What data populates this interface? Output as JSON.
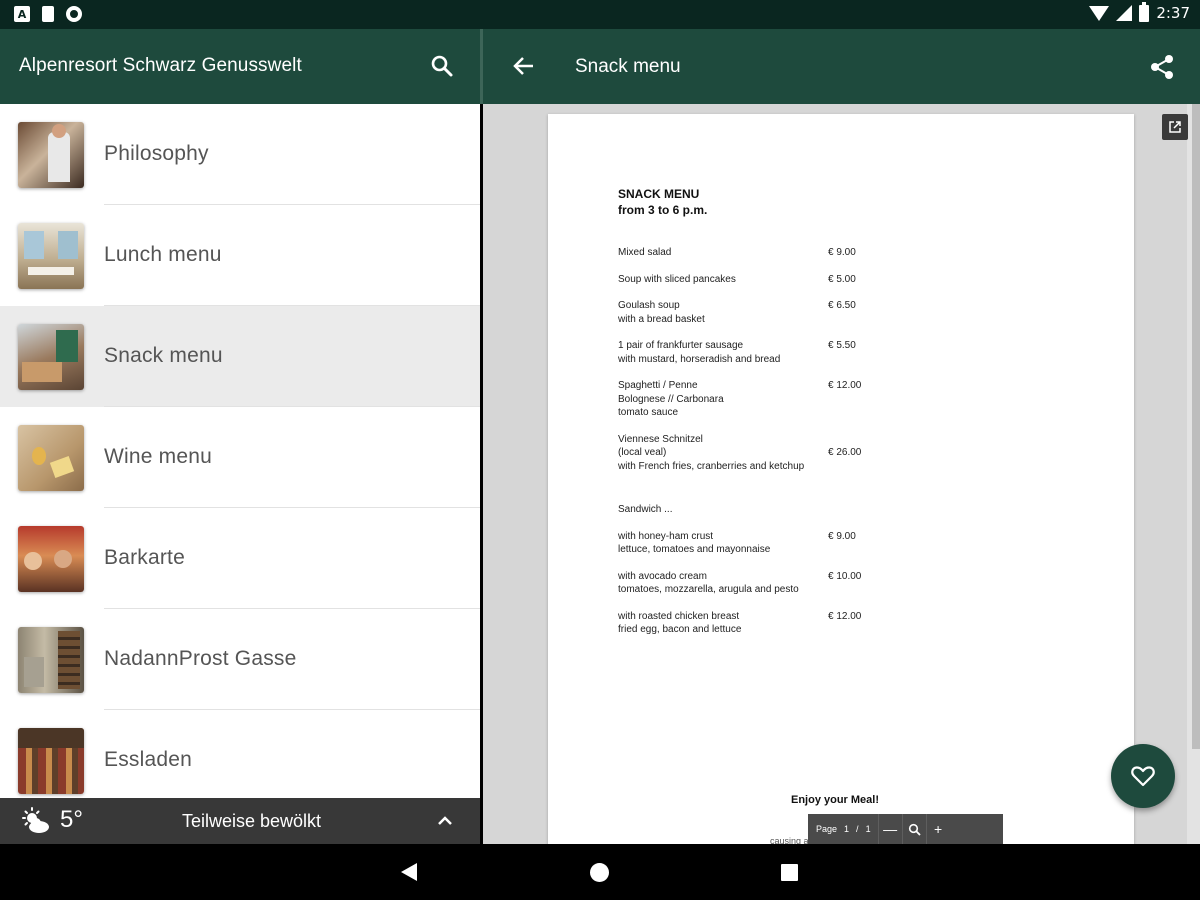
{
  "status_bar": {
    "time": "2:37",
    "icons": [
      "a-icon",
      "sd-card-icon",
      "circle-icon",
      "wifi-icon",
      "signal-icon",
      "battery-icon"
    ]
  },
  "left_panel": {
    "title": "Alpenresort Schwarz Genusswelt",
    "search_icon": "search-icon",
    "items": [
      {
        "label": "Philosophy",
        "selected": false
      },
      {
        "label": "Lunch menu",
        "selected": false
      },
      {
        "label": "Snack menu",
        "selected": true
      },
      {
        "label": "Wine menu",
        "selected": false
      },
      {
        "label": "Barkarte",
        "selected": false
      },
      {
        "label": "NadannProst Gasse",
        "selected": false
      },
      {
        "label": "Essladen",
        "selected": false
      }
    ],
    "weather": {
      "temperature": "5°",
      "condition": "Teilweise bewölkt",
      "icon": "partly-cloudy-icon"
    }
  },
  "right_panel": {
    "title": "Snack menu",
    "back_icon": "arrow-back-icon",
    "share_icon": "share-icon",
    "document": {
      "heading_line1": "SNACK MENU",
      "heading_line2": "from 3 to 6 p.m.",
      "items": [
        {
          "lines": [
            "Mixed salad"
          ],
          "price": "€ 9.00"
        },
        {
          "lines": [
            "Soup with sliced pancakes"
          ],
          "price": "€ 5.00"
        },
        {
          "lines": [
            "Goulash soup",
            "with a bread basket"
          ],
          "price": "€ 6.50"
        },
        {
          "lines": [
            "1 pair of frankfurter sausage",
            "with mustard, horseradish and bread"
          ],
          "price": "€ 5.50"
        },
        {
          "lines": [
            "Spaghetti / Penne",
            "Bolognese // Carbonara",
            "tomato sauce"
          ],
          "price": "€ 12.00"
        },
        {
          "lines": [
            "Viennese Schnitzel",
            "(local veal)",
            "with French fries, cranberries and ketchup"
          ],
          "price": "€ 26.00"
        }
      ],
      "sandwich_heading": "Sandwich ...",
      "sandwich_items": [
        {
          "lines": [
            "with honey-ham crust",
            "lettuce, tomatoes and mayonnaise"
          ],
          "price": "€ 9.00"
        },
        {
          "lines": [
            "with avocado cream",
            "tomatoes, mozzarella, arugula and pesto"
          ],
          "price": "€ 10.00"
        },
        {
          "lines": [
            "with roasted chicken breast",
            "fried egg, bacon and lettuce"
          ],
          "price": "€ 12.00"
        }
      ],
      "footer": "Enjoy your Meal!",
      "footer_small": "causing allergies or intolerances"
    },
    "pdf_toolbar": {
      "page_label": "Page",
      "current_page": "1",
      "separator": "/",
      "total_pages": "1",
      "zoom_out": "—",
      "zoom_icon": "magnifier-icon",
      "zoom_in": "+"
    },
    "popout_icon": "open-external-icon",
    "favorite_icon": "heart-icon"
  },
  "nav_bar": {
    "icons": [
      "nav-back-icon",
      "nav-home-icon",
      "nav-recents-icon"
    ]
  },
  "colors": {
    "primary": "#1e4a3d",
    "status_bar": "#0a2620",
    "weather_bar": "#383838",
    "selected_row": "#ebebeb"
  }
}
